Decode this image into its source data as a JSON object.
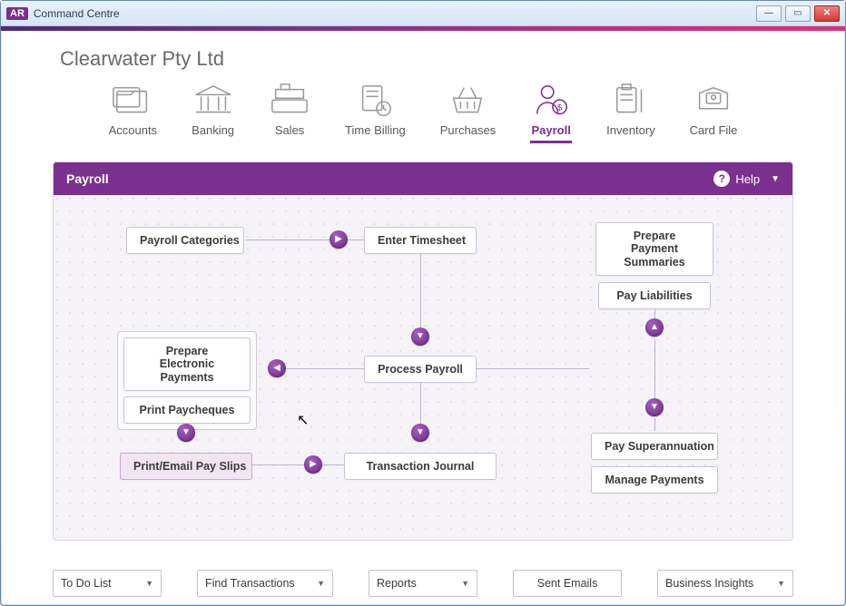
{
  "window": {
    "app_badge": "AR",
    "title": "Command Centre"
  },
  "company_name": "Clearwater Pty Ltd",
  "nav": {
    "items": [
      {
        "label": "Accounts"
      },
      {
        "label": "Banking"
      },
      {
        "label": "Sales"
      },
      {
        "label": "Time Billing"
      },
      {
        "label": "Purchases"
      },
      {
        "label": "Payroll"
      },
      {
        "label": "Inventory"
      },
      {
        "label": "Card File"
      }
    ],
    "active_index": 5
  },
  "panel": {
    "title": "Payroll",
    "help_label": "Help"
  },
  "tasks": {
    "payroll_categories": "Payroll Categories",
    "enter_timesheet": "Enter Timesheet",
    "prepare_payment_summaries": "Prepare Payment Summaries",
    "pay_liabilities": "Pay Liabilities",
    "prepare_electronic_payments": "Prepare Electronic Payments",
    "print_paycheques": "Print Paycheques",
    "process_payroll": "Process Payroll",
    "print_email_pay_slips": "Print/Email Pay Slips",
    "transaction_journal": "Transaction Journal",
    "pay_superannuation": "Pay Superannuation",
    "manage_payments": "Manage Payments"
  },
  "bottom": {
    "todo": "To Do List",
    "find": "Find Transactions",
    "reports": "Reports",
    "sent_emails": "Sent Emails",
    "insights": "Business Insights"
  }
}
